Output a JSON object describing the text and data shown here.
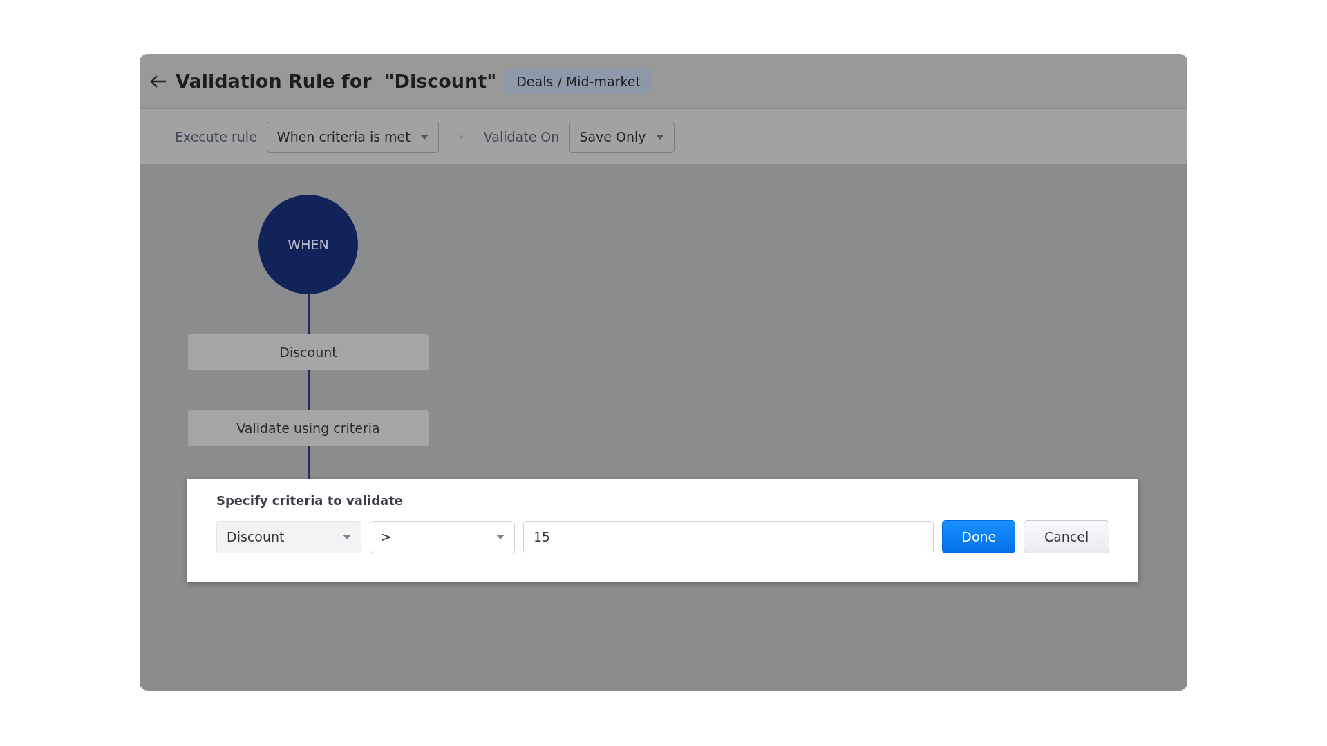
{
  "header": {
    "title": "Validation Rule for  \"Discount\"",
    "badge": "Deals / Mid-market"
  },
  "toolbar": {
    "execute_label": "Execute rule",
    "execute_value": "When criteria is met",
    "validate_label": "Validate On",
    "validate_value": "Save Only"
  },
  "flow": {
    "start": "WHEN",
    "steps": [
      "Discount",
      "Validate using criteria"
    ]
  },
  "criteria_panel": {
    "title": "Specify criteria to validate",
    "field": "Discount",
    "operator": ">",
    "value": "15",
    "buttons": [
      {
        "label": "Done",
        "kind": "primary"
      },
      {
        "label": "Cancel",
        "kind": "secondary"
      }
    ]
  }
}
